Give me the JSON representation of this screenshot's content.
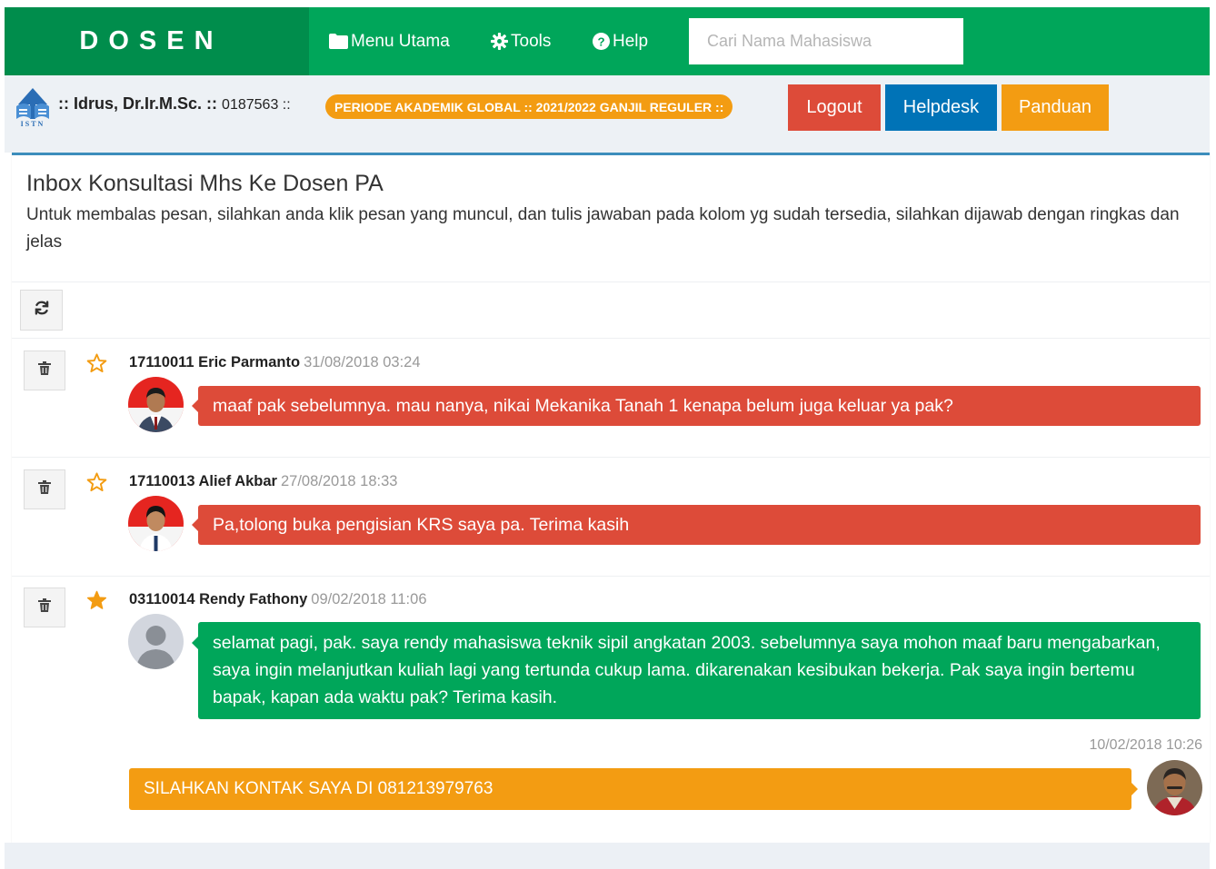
{
  "brand": "DOSEN",
  "nav": {
    "menu_utama": "Menu Utama",
    "tools": "Tools",
    "help": "Help"
  },
  "search": {
    "placeholder": "Cari Nama Mahasiswa",
    "value": ""
  },
  "user": {
    "prefix": ":: ",
    "name": "Idrus, Dr.Ir.M.Sc.",
    "separator": " :: ",
    "nip": "0187563 ::"
  },
  "logo_text": "ISTN",
  "periode": "PERIODE AKADEMIK GLOBAL :: 2021/2022 GANJIL REGULER ::",
  "buttons": {
    "logout": "Logout",
    "helpdesk": "Helpdesk",
    "panduan": "Panduan"
  },
  "colors": {
    "green": "#00a65a",
    "dark_green": "#008d4c",
    "red": "#dd4b39",
    "blue": "#0073b7",
    "orange": "#f39c12"
  },
  "inbox": {
    "title": "Inbox Konsultasi Mhs Ke Dosen PA",
    "description": "Untuk membalas pesan, silahkan anda klik pesan yang muncul, dan tulis jawaban pada kolom yg sudah tersedia, silahkan dijawab dengan ringkas dan jelas"
  },
  "messages": [
    {
      "sender": "17110011 Eric Parmanto",
      "timestamp": "31/08/2018 03:24",
      "text": "maaf pak sebelumnya. mau nanya, nikai Mekanika Tanah 1 kenapa belum juga keluar ya pak?",
      "starred": false,
      "color": "red"
    },
    {
      "sender": "17110013 Alief Akbar",
      "timestamp": "27/08/2018 18:33",
      "text": "Pa,tolong buka pengisian KRS saya pa. Terima kasih",
      "starred": false,
      "color": "red"
    },
    {
      "sender": "03110014 Rendy Fathony",
      "timestamp": "09/02/2018 11:06",
      "text": "selamat pagi, pak. saya rendy mahasiswa teknik sipil angkatan 2003. sebelumnya saya mohon maaf baru mengabarkan, saya ingin melanjutkan kuliah lagi yang tertunda cukup lama. dikarenakan kesibukan bekerja. Pak saya ingin bertemu bapak, kapan ada waktu pak? Terima kasih.",
      "starred": true,
      "color": "green",
      "reply": {
        "timestamp": "10/02/2018 10:26",
        "text": "SILAHKAN KONTAK SAYA DI 081213979763"
      }
    }
  ]
}
